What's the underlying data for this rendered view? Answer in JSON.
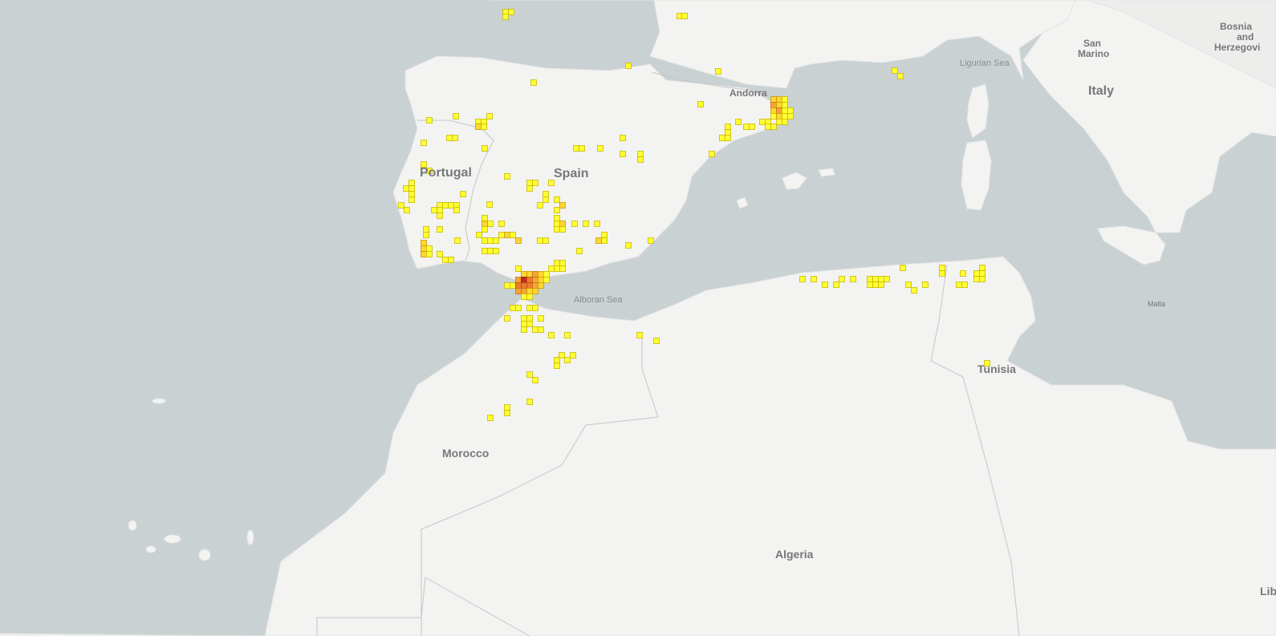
{
  "map": {
    "labels": {
      "portugal": "Portugal",
      "spain": "Spain",
      "andorra": "Andorra",
      "italy": "Italy",
      "san_marino": "San Marino",
      "bosnia": "Bosnia and Herzegovina",
      "ligurian_sea": "Ligurian Sea",
      "alboran_sea": "Alboran Sea",
      "morocco": "Morocco",
      "algeria": "Algeria",
      "tunisia": "Tunisia",
      "malta": "Malta",
      "libya": "Lib"
    },
    "colors": {
      "water": "#c9d1d3",
      "land": "#f3f3f2",
      "border": "#c6c6c6",
      "density_1": "#ffff33",
      "density_2": "#ffd633",
      "density_3": "#f7a534",
      "density_4": "#ee7a2a",
      "density_5": "#c62a1d"
    }
  }
}
